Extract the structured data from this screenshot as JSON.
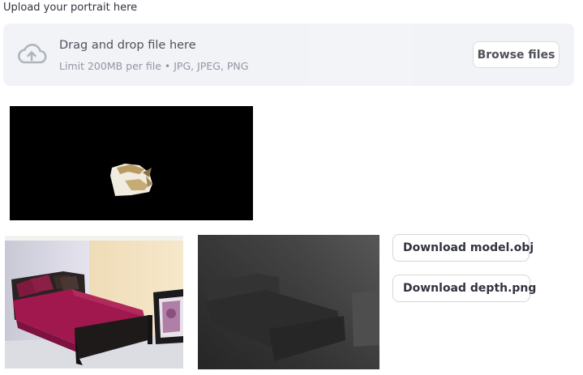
{
  "uploader": {
    "label": "Upload your portrait here",
    "title": "Drag and drop file here",
    "limit": "Limit 200MB per file • JPG, JPEG, PNG",
    "browse_label": "Browse files",
    "icon": "cloud-upload-icon"
  },
  "outputs": {
    "mask_preview": "segmentation-mask-image",
    "photo": "bedroom-photo-image",
    "depth_map": "depth-map-image"
  },
  "downloads": {
    "model_label": "Download model.obj",
    "depth_label": "Download depth.png"
  },
  "colors": {
    "uploader_bg": "#f0f2f6",
    "text": "#31333f",
    "muted": "#808495",
    "border": "#d6d6d9"
  }
}
